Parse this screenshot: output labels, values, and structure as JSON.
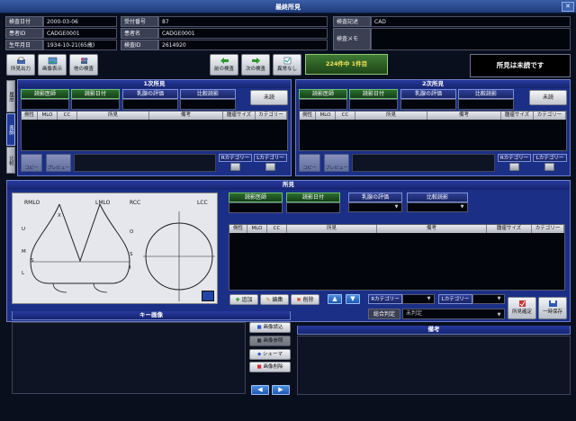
{
  "window": {
    "title": "最終所見",
    "close": "✕"
  },
  "patient": {
    "exam_date_label": "検査日付",
    "exam_date": "2000-03-06",
    "receipt_label": "受付番号",
    "receipt": "87",
    "patient_id_label": "患者ID",
    "patient_id": "CADGE0001",
    "patient_name_label": "患者名",
    "patient_name": "CADGE0001",
    "birth_label": "生年月日",
    "birth": "1934-10-21(65歳)",
    "exam_no_label": "検査ID",
    "exam_no": "2614920",
    "exam_desc_label": "検査記述",
    "exam_desc": "CAD",
    "exam_memo_label": "検査メモ"
  },
  "toolbar": {
    "report_output": "所見出力",
    "image_display": "画像表示",
    "other_exam": "他の検査",
    "prev_exam": "前の検査",
    "next_exam": "次の検査",
    "no_findings": "異常なし",
    "counter": "224件中 1件目",
    "status_banner": "所見は未読です"
  },
  "first_reading": {
    "header": "1次所見",
    "reader": "読影医師",
    "read_date": "読影日付",
    "density": "乳腺の評価",
    "compare": "比較読影",
    "unread": "未読",
    "cols": [
      "側性",
      "MLO",
      "CC",
      "所見",
      "備考",
      "腫瘤サイズ",
      "カテゴリー"
    ],
    "copy": "コピー",
    "preview": "プレビュー",
    "r_cat": "Rカテゴリー",
    "l_cat": "Lカテゴリー"
  },
  "second_reading": {
    "header": "2次所見",
    "reader": "読影医師",
    "read_date": "読影日付",
    "density": "乳腺の評価",
    "compare": "比較読影",
    "unread": "未読",
    "cols": [
      "側性",
      "MLO",
      "CC",
      "所見",
      "備考",
      "腫瘤サイズ",
      "カテゴリー"
    ],
    "copy": "コピー",
    "preview": "プレビュー",
    "r_cat": "Rカテゴリー",
    "l_cat": "Lカテゴリー"
  },
  "side_tabs": {
    "t1": "履歴",
    "t2": "表師",
    "t3": "比較"
  },
  "findings": {
    "header": "所見",
    "reader": "読影医師",
    "read_date": "読影日付",
    "density": "乳腺の評価",
    "compare": "比較読影",
    "cols": [
      "側性",
      "MLO",
      "CC",
      "所見",
      "備考",
      "腫瘤サイズ",
      "カテゴリー"
    ],
    "add": "追加",
    "edit": "編集",
    "delete": "削除",
    "r_cat": "Rカテゴリー",
    "l_cat": "Lカテゴリー",
    "overall": "総合判定",
    "overall_value": "未判定",
    "confirm": "所見確定",
    "temp_save": "一時保存"
  },
  "schema": {
    "rmlo": "RMLO",
    "lmlo": "LMLO",
    "rcc": "RCC",
    "lcc": "LCC",
    "u": "U",
    "m": "M",
    "l": "L",
    "x": "X",
    "s": "S",
    "o": "O",
    "s2": "S",
    "i": "I"
  },
  "key_images": {
    "header": "キー画像",
    "read_image": "画像読込",
    "ref_image": "画像参照",
    "schema": "シェーマ",
    "delete_image": "画像削除"
  },
  "remarks": {
    "header": "備考"
  }
}
